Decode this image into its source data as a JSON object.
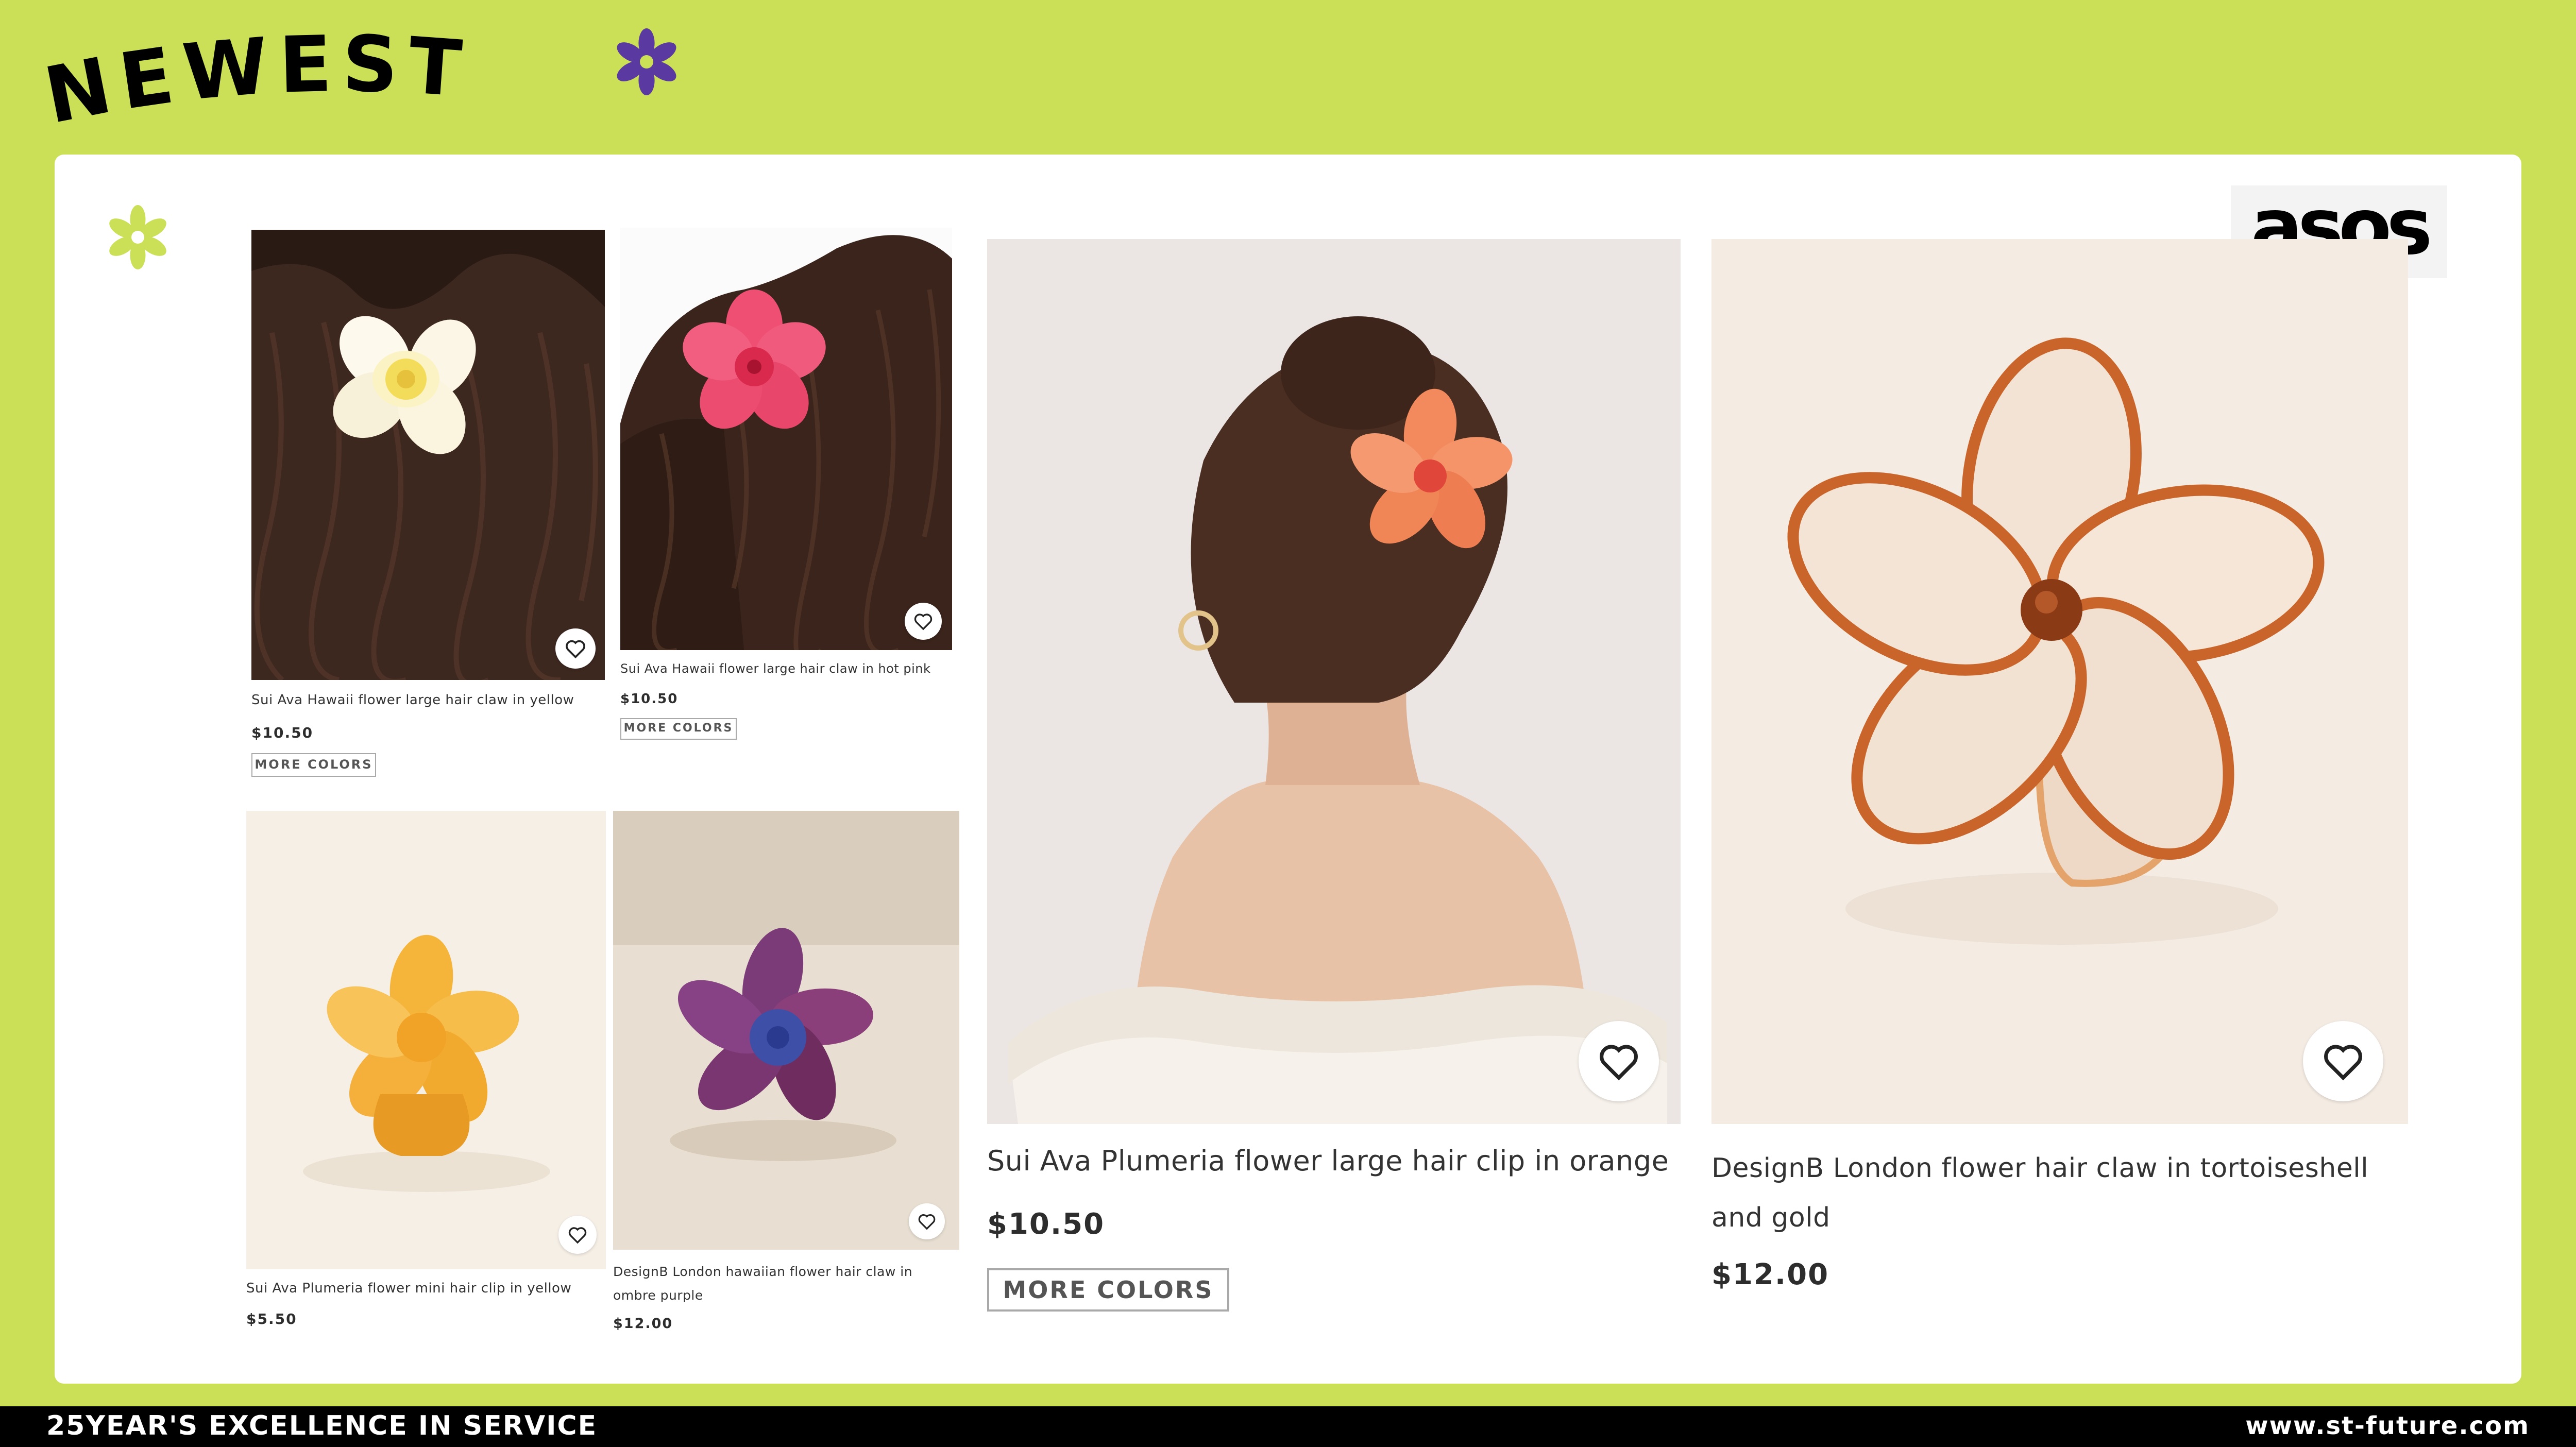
{
  "header": {
    "title": "NEWEST"
  },
  "brand": {
    "logo_text": "asos"
  },
  "colors": {
    "background": "#cbe057",
    "accent_purple": "#5a3aa0",
    "accent_green": "#cbe057",
    "footer_bg": "#000000"
  },
  "products": [
    {
      "title": "Sui Ava Hawaii flower large hair claw in yellow",
      "price": "$10.50",
      "more_colors": "MORE COLORS",
      "icon": "heart-icon"
    },
    {
      "title": "Sui Ava Hawaii flower large hair claw in hot pink",
      "price": "$10.50",
      "more_colors": "MORE COLORS",
      "icon": "heart-icon"
    },
    {
      "title": "Sui Ava Plumeria flower mini hair clip in yellow",
      "price": "$5.50",
      "icon": "heart-icon"
    },
    {
      "title": "DesignB London hawaiian flower hair claw in ombre purple",
      "price": "$12.00",
      "icon": "heart-icon"
    },
    {
      "title": "Sui Ava Plumeria flower large hair clip in orange",
      "price": "$10.50",
      "more_colors": "MORE COLORS",
      "icon": "heart-icon"
    },
    {
      "title": "DesignB London flower hair claw in tortoiseshell and gold",
      "price": "$12.00",
      "icon": "heart-icon"
    }
  ],
  "footer": {
    "tagline": "25YEAR'S EXCELLENCE IN SERVICE",
    "website": "www.st-future.com"
  }
}
